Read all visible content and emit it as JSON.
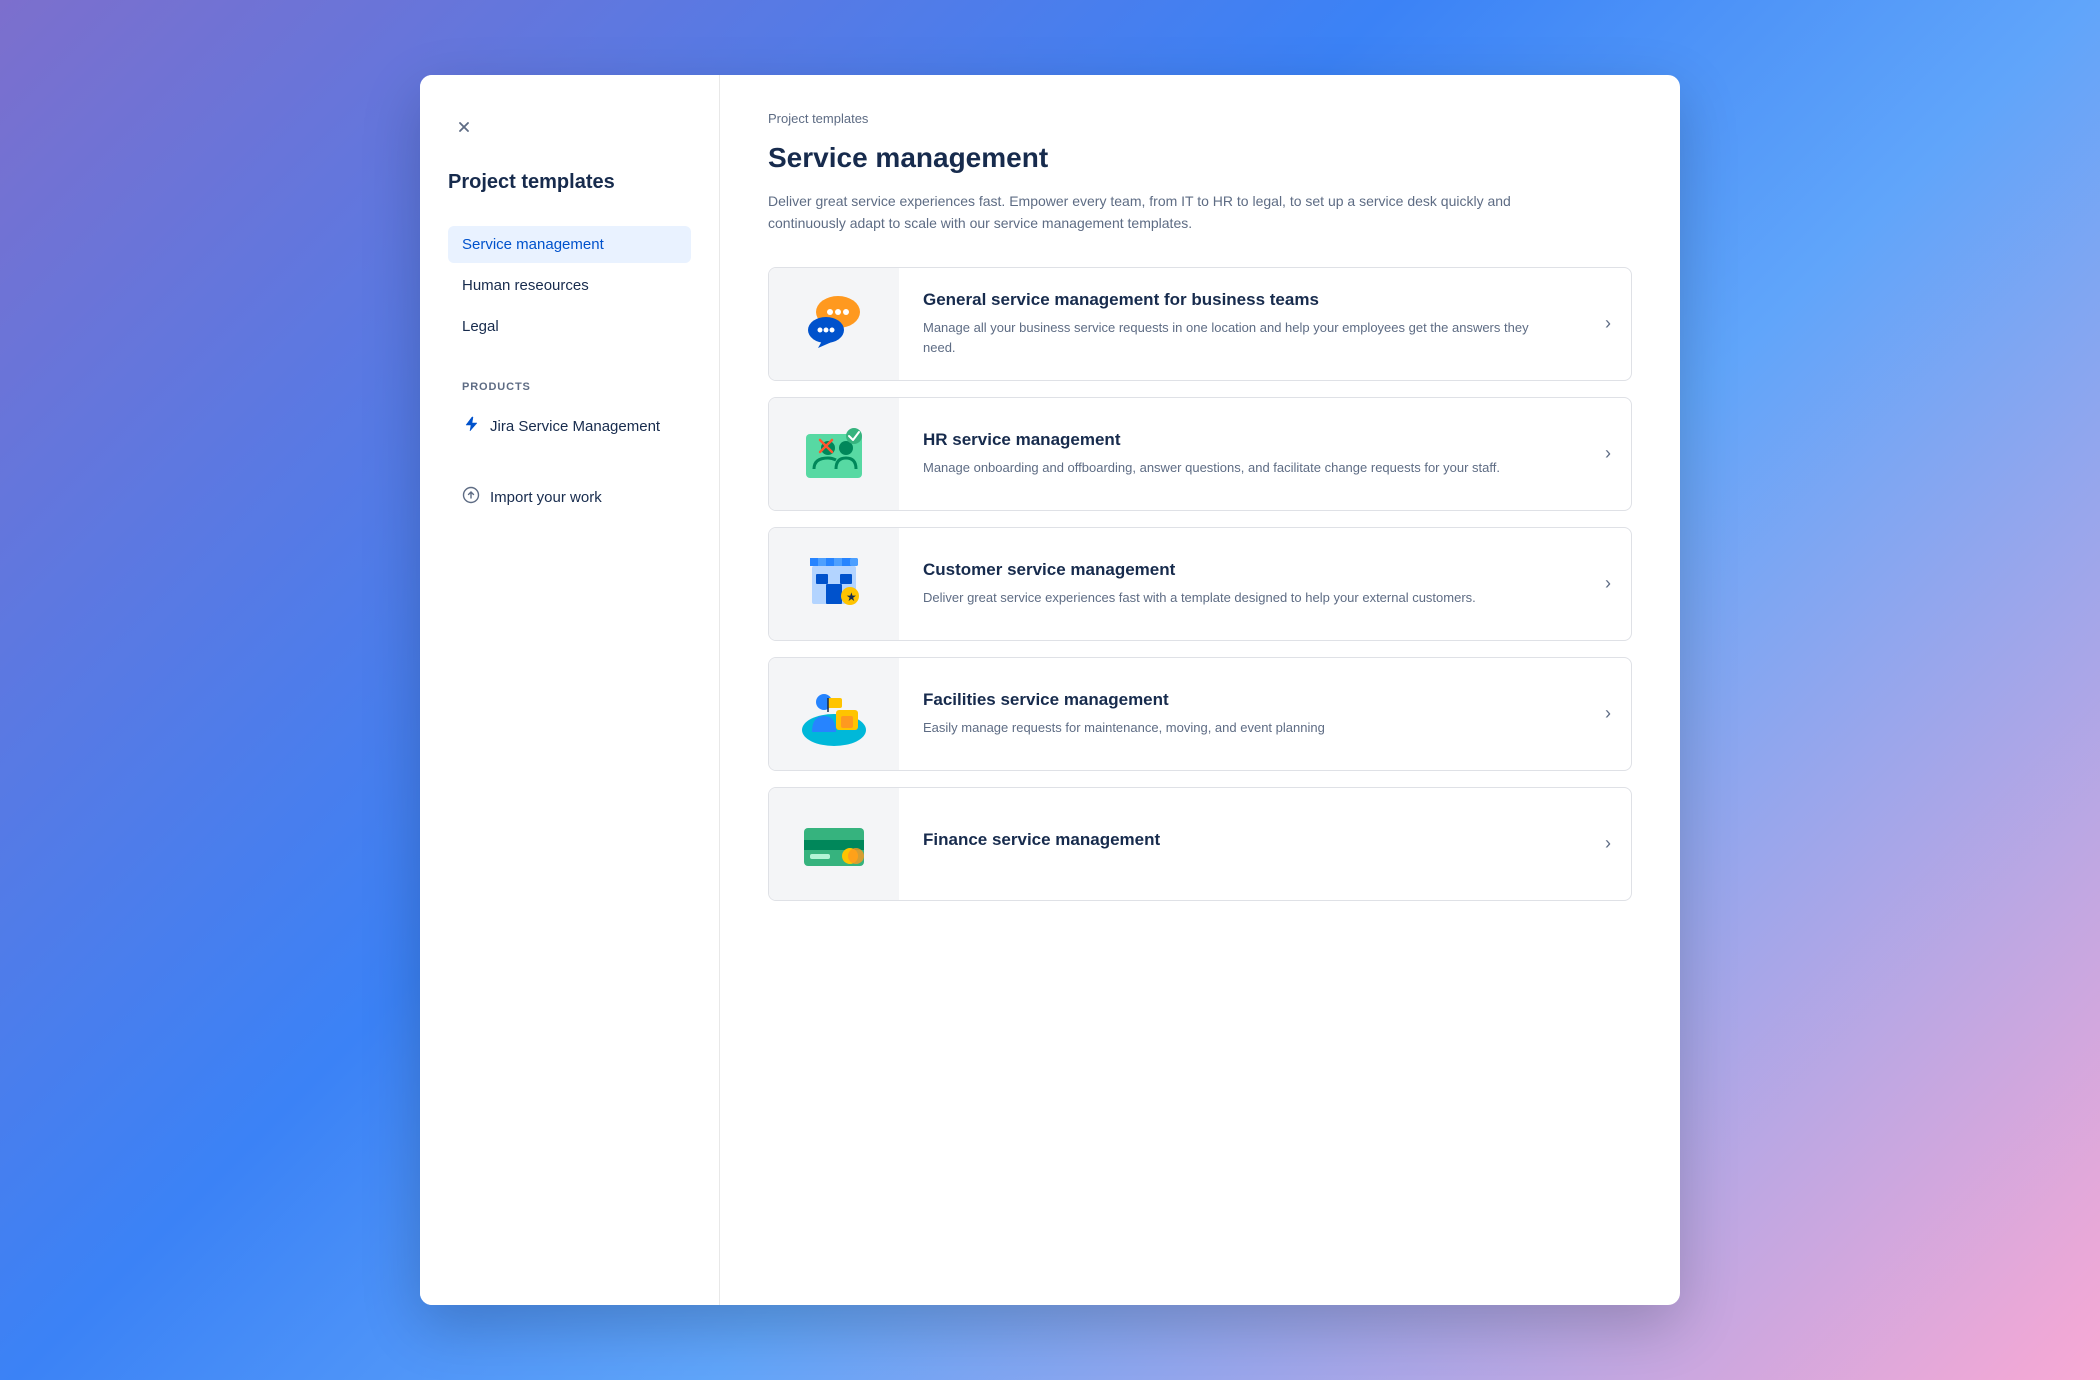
{
  "background": "gradient",
  "modal": {
    "sidebar": {
      "close_label": "×",
      "title": "Project templates",
      "nav_items": [
        {
          "label": "Service management",
          "active": true
        },
        {
          "label": "Human reseources",
          "active": false
        },
        {
          "label": "Legal",
          "active": false
        }
      ],
      "products_section_label": "PRODUCTS",
      "product_items": [
        {
          "label": "Jira Service Management",
          "icon": "lightning"
        }
      ],
      "import_label": "Import your work",
      "import_icon": "cloud-upload"
    },
    "main": {
      "breadcrumb": "Project templates",
      "page_title": "Service management",
      "page_description": "Deliver great service experiences fast. Empower every team, from IT to HR to legal, to set up a service desk quickly and continuously adapt to scale with our service management templates.",
      "templates": [
        {
          "id": "general",
          "title": "General service management for business teams",
          "description": "Manage all your business service requests in one location and help your employees get the answers they need.",
          "icon_type": "chat"
        },
        {
          "id": "hr",
          "title": "HR service management",
          "description": "Manage onboarding and offboarding, answer questions, and facilitate change requests for your staff.",
          "icon_type": "hr"
        },
        {
          "id": "customer",
          "title": "Customer service management",
          "description": "Deliver great service experiences fast with a template designed to help your external customers.",
          "icon_type": "customer"
        },
        {
          "id": "facilities",
          "title": "Facilities service management",
          "description": "Easily manage requests for maintenance, moving, and event planning",
          "icon_type": "facilities"
        },
        {
          "id": "finance",
          "title": "Finance service management",
          "description": "",
          "icon_type": "finance"
        }
      ]
    }
  }
}
